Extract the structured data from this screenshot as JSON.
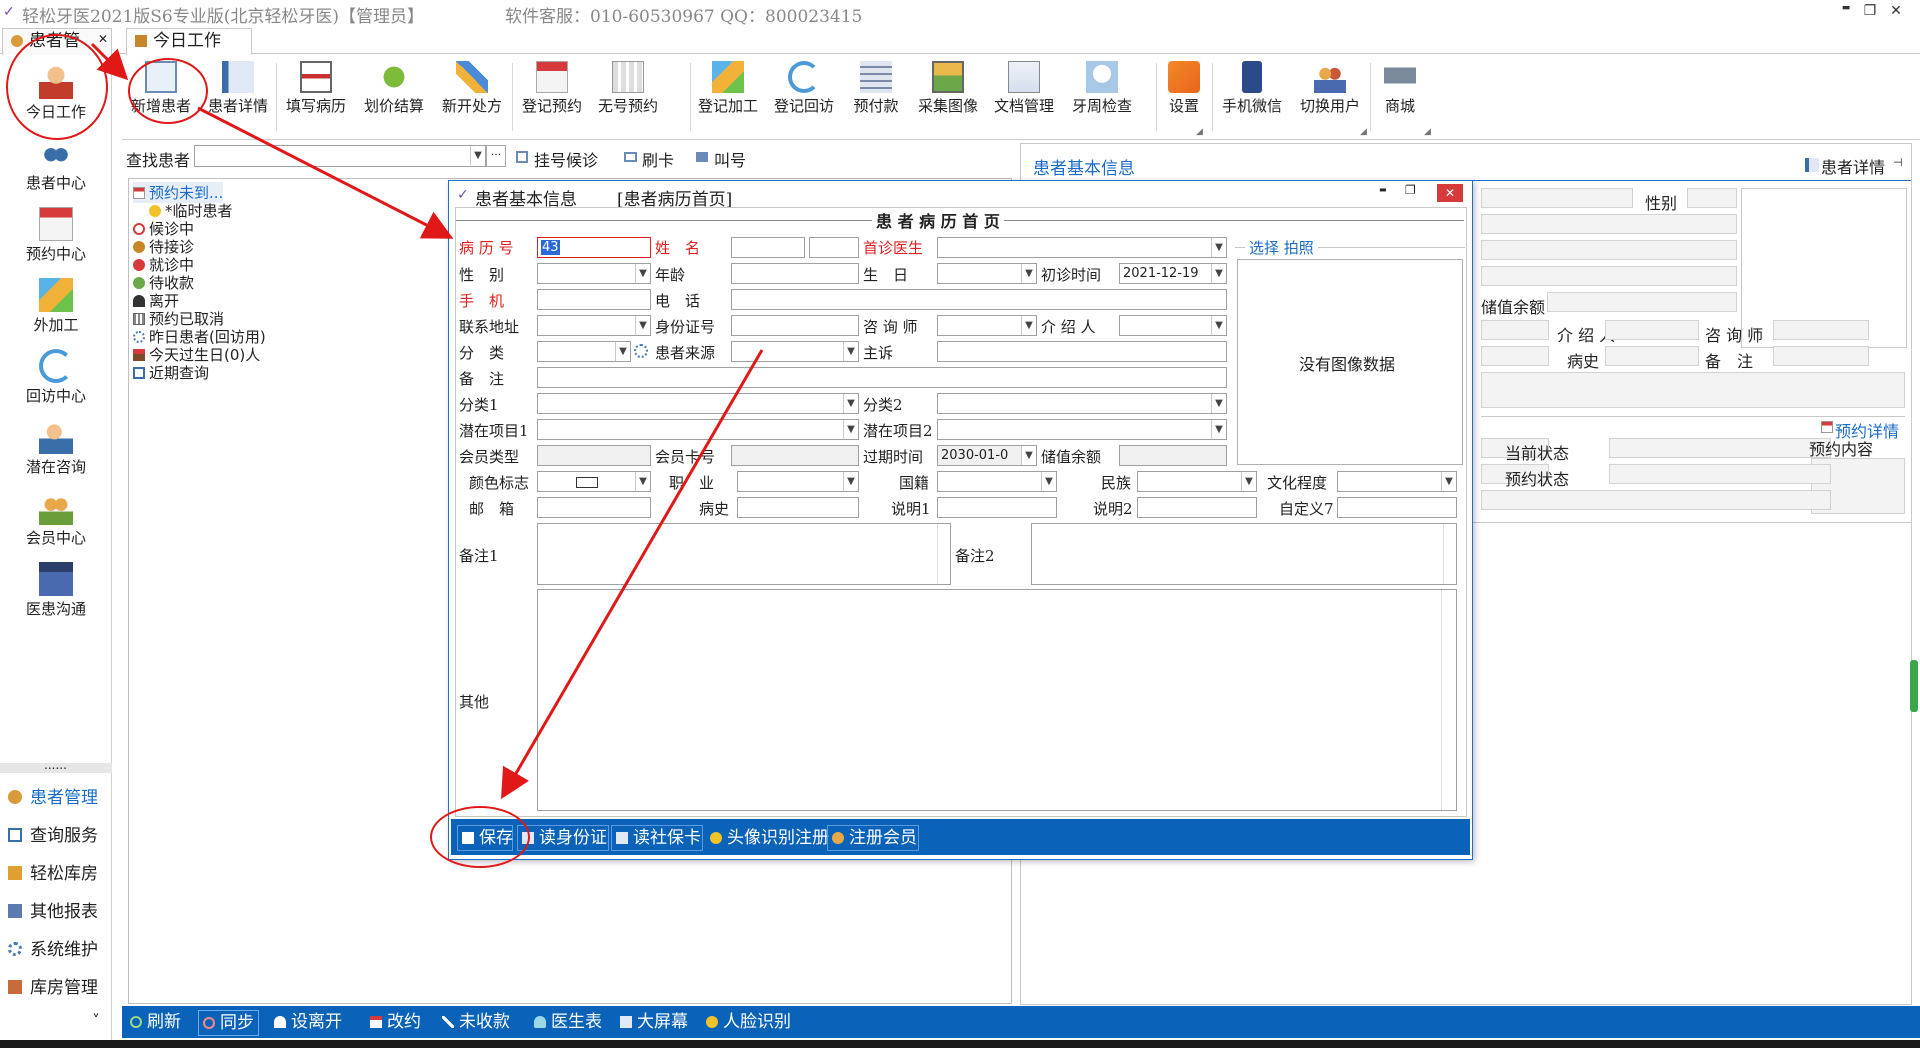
{
  "app": {
    "title": "轻松牙医2021版S6专业版(北京轻松牙医)【管理员】",
    "service": "软件客服：010-60530967 QQ：800023415"
  },
  "window_controls": {
    "minimize": "▬",
    "restore": "❐",
    "close": "✕"
  },
  "tabs": {
    "patient_mgmt": "患者管",
    "today_work": "今日工作"
  },
  "ribbon": {
    "buttons": [
      "新增患者",
      "患者详情",
      "填写病历",
      "划价结算",
      "新开处方",
      "登记预约",
      "无号预约",
      "登记加工",
      "登记回访",
      "预付款",
      "采集图像",
      "文档管理",
      "牙周检查",
      "设置",
      "手机微信",
      "切换用户",
      "商城"
    ]
  },
  "leftnav": {
    "items": [
      "今日工作",
      "患者中心",
      "预约中心",
      "外加工",
      "回访中心",
      "潜在咨询",
      "会员中心",
      "医患沟通"
    ],
    "dots": "......",
    "menu": [
      "患者管理",
      "查询服务",
      "轻松库房",
      "其他报表",
      "系统维护",
      "库房管理"
    ],
    "more": "˅"
  },
  "search": {
    "label": "查找患者",
    "dots": "···",
    "reg_queue": "挂号候诊",
    "swipe": "刷卡",
    "call": "叫号"
  },
  "tree": {
    "items": [
      "预约未到...",
      "*临时患者",
      "候诊中",
      "待接诊",
      "就诊中",
      "待收款",
      "离开",
      "预约已取消",
      "昨日患者(回访用)",
      "今天过生日(0)人",
      "近期查询"
    ]
  },
  "right_panel": {
    "title": "患者基本信息",
    "detail_link": "患者详情",
    "pin": "⊣",
    "labels": {
      "gender": "性别",
      "balance": "储值余额",
      "referrer": "介 绍 人",
      "consultant": "咨 询 师",
      "history": "病史",
      "remark": "备　注",
      "appt_detail": "预约详情",
      "current_status": "当前状态",
      "appt_content": "预约内容",
      "appt_status": "预约状态"
    }
  },
  "dialog": {
    "title": "患者基本信息",
    "subtitle": "[患者病历首页]",
    "heading": "患 者 病 历 首 页",
    "photo_links": "选择 拍照",
    "no_image": "没有图像数据",
    "labels": {
      "record_no": "病 历 号",
      "name": "姓　名",
      "first_doctor": "首诊医生",
      "gender": "性　别",
      "age": "年龄",
      "birthday": "生　日",
      "first_visit": "初诊时间",
      "mobile": "手　机",
      "phone": "电　话",
      "address": "联系地址",
      "id_no": "身份证号",
      "consultant": "咨 询 师",
      "referrer": "介 绍 人",
      "category": "分　类",
      "source": "患者来源",
      "complaint": "主诉",
      "remark": "备　注",
      "category1": "分类1",
      "category2": "分类2",
      "potential1": "潜在项目1",
      "potential2": "潜在项目2",
      "member_type": "会员类型",
      "member_card": "会员卡号",
      "expire": "过期时间",
      "balance": "储值余额",
      "color_tag": "颜色标志",
      "job": "职　业",
      "nation": "国籍",
      "ethnic": "民族",
      "education": "文化程度",
      "email": "邮　箱",
      "history": "病史",
      "note1": "说明1",
      "note2": "说明2",
      "custom7": "自定义7",
      "remark1": "备注1",
      "remark2": "备注2",
      "other": "其他"
    },
    "values": {
      "record_no": "43",
      "first_visit": "2021-12-19",
      "expire": "2030-01-0"
    },
    "footer": [
      "保存",
      "读身份证",
      "读社保卡",
      "头像识别注册",
      "注册会员"
    ]
  },
  "bottom": {
    "buttons": [
      "刷新",
      "同步",
      "设离开",
      "改约",
      "未收款",
      "医生表",
      "大屏幕",
      "人脸识别"
    ]
  },
  "colors": {
    "accent": "#0a63b8",
    "required": "#e02020",
    "annotation": "#e01818",
    "link": "#1a6cc8"
  }
}
